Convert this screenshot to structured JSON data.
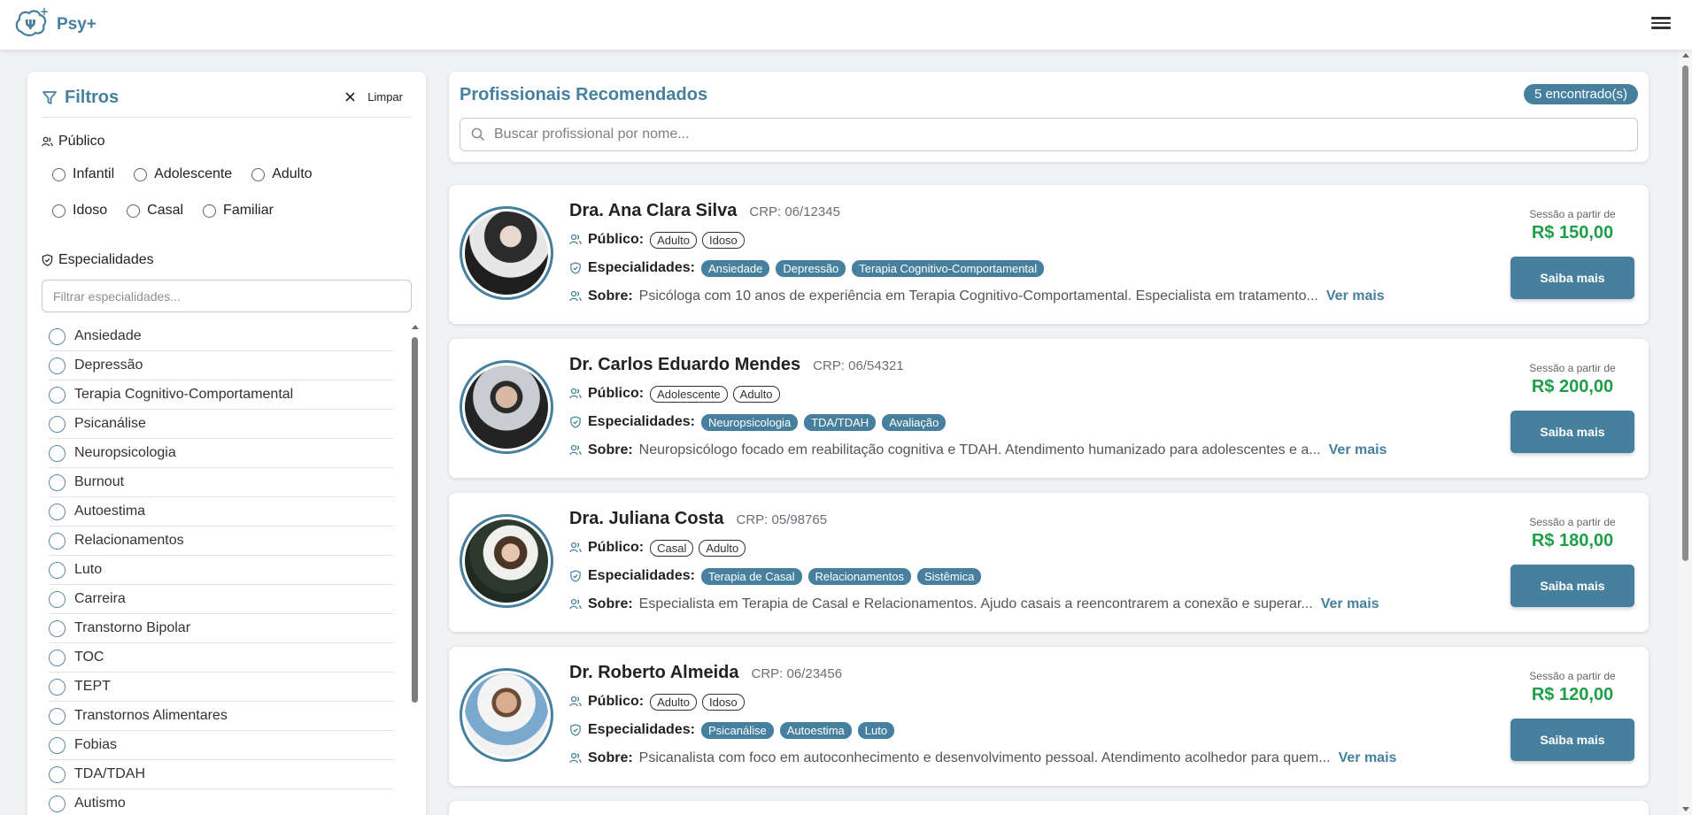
{
  "app": {
    "name": "Psy+"
  },
  "filters": {
    "title": "Filtros",
    "clear_label": "Limpar",
    "publico_title": "Público",
    "publico_options": [
      "Infantil",
      "Adolescente",
      "Adulto",
      "Idoso",
      "Casal",
      "Familiar"
    ],
    "especialidades_title": "Especialidades",
    "especialidades_placeholder": "Filtrar especialidades...",
    "especialidades": [
      "Ansiedade",
      "Depressão",
      "Terapia Cognitivo-Comportamental",
      "Psicanálise",
      "Neuropsicologia",
      "Burnout",
      "Autoestima",
      "Relacionamentos",
      "Luto",
      "Carreira",
      "Transtorno Bipolar",
      "TOC",
      "TEPT",
      "Transtornos Alimentares",
      "Fobias",
      "TDA/TDAH",
      "Autismo"
    ]
  },
  "results": {
    "title": "Profissionais Recomendados",
    "count": "5 encontrado(s)",
    "search_placeholder": "Buscar profissional por nome..."
  },
  "labels": {
    "publico": "Público:",
    "especialidades": "Especialidades:",
    "sobre": "Sobre:",
    "ver_mais": "Ver mais",
    "price_label": "Sessão a partir de",
    "button": "Saiba mais"
  },
  "professionals": [
    {
      "name": "Dra. Ana Clara Silva",
      "crp": "CRP: 06/12345",
      "publico": [
        "Adulto",
        "Idoso"
      ],
      "especialidades": [
        "Ansiedade",
        "Depressão",
        "Terapia Cognitivo-Comportamental"
      ],
      "sobre": "Psicóloga com 10 anos de experiência em Terapia Cognitivo-Comportamental. Especialista em tratamento...",
      "price": "R$ 150,00"
    },
    {
      "name": "Dr. Carlos Eduardo Mendes",
      "crp": "CRP: 06/54321",
      "publico": [
        "Adolescente",
        "Adulto"
      ],
      "especialidades": [
        "Neuropsicologia",
        "TDA/TDAH",
        "Avaliação"
      ],
      "sobre": "Neuropsicólogo focado em reabilitação cognitiva e TDAH. Atendimento humanizado para adolescentes e a...",
      "price": "R$ 200,00"
    },
    {
      "name": "Dra. Juliana Costa",
      "crp": "CRP: 05/98765",
      "publico": [
        "Casal",
        "Adulto"
      ],
      "especialidades": [
        "Terapia de Casal",
        "Relacionamentos",
        "Sistêmica"
      ],
      "sobre": "Especialista em Terapia de Casal e Relacionamentos. Ajudo casais a reencontrarem a conexão e superar...",
      "price": "R$ 180,00"
    },
    {
      "name": "Dr. Roberto Almeida",
      "crp": "CRP: 06/23456",
      "publico": [
        "Adulto",
        "Idoso"
      ],
      "especialidades": [
        "Psicanálise",
        "Autoestima",
        "Luto"
      ],
      "sobre": "Psicanalista com foco em autoconhecimento e desenvolvimento pessoal. Atendimento acolhedor para quem...",
      "price": "R$ 120,00"
    }
  ],
  "colors": {
    "brand": "#46809e",
    "price": "#1f9e4a"
  }
}
